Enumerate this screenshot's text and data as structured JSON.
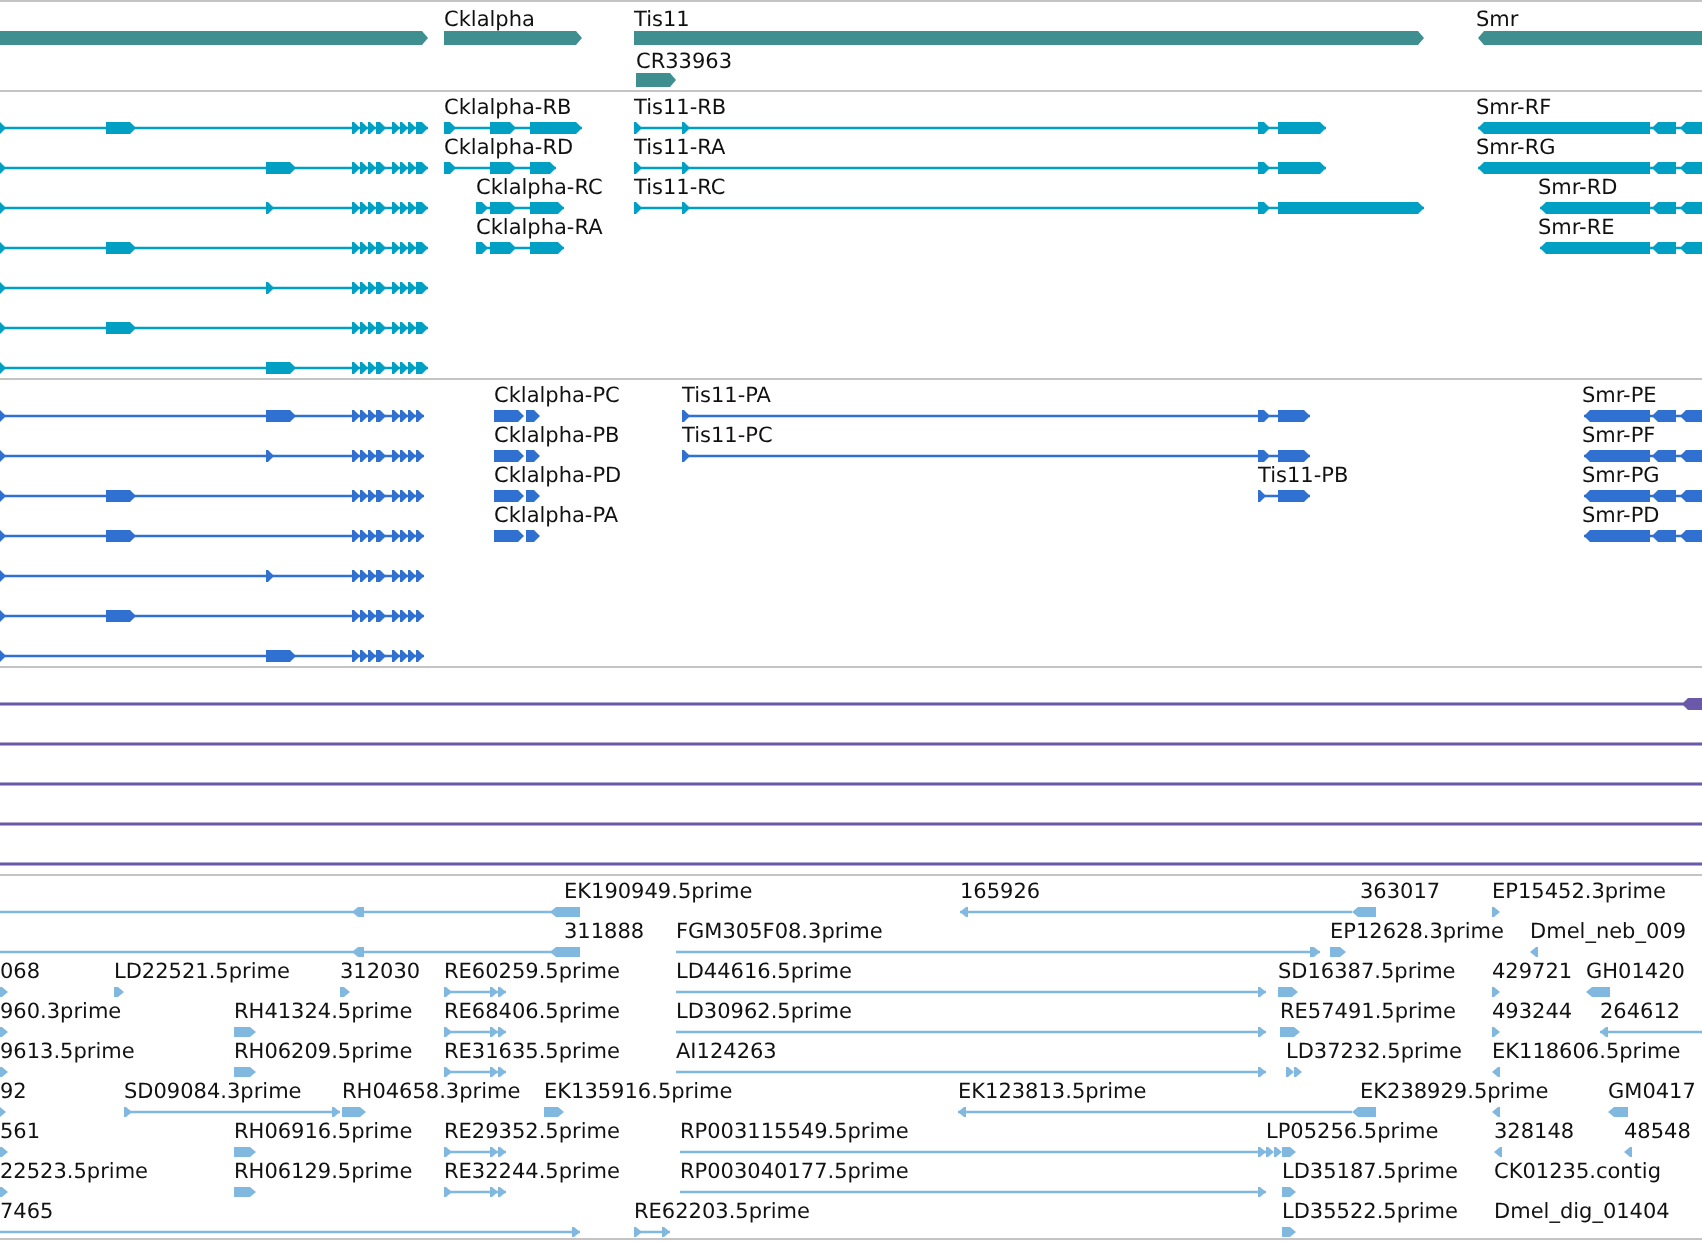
{
  "tracks": [
    {
      "kind": "gene",
      "color": "#3f8f91",
      "features": [
        {
          "reverse": false
        },
        {
          "label": "Cklalpha",
          "reverse": false
        },
        {
          "label": "Tis11",
          "reverse": false
        },
        {
          "label": "CR33963",
          "reverse": false
        },
        {
          "label": "Smr",
          "reverse": true
        }
      ]
    },
    {
      "kind": "transcript",
      "color": "#00a0c4",
      "features": [
        {
          "reverse": false
        },
        {
          "reverse": false
        },
        {
          "reverse": false
        },
        {
          "reverse": false
        },
        {
          "reverse": false
        },
        {
          "reverse": false
        },
        {
          "reverse": false
        },
        {
          "label": "Cklalpha-RB",
          "reverse": false
        },
        {
          "label": "Cklalpha-RD",
          "reverse": false
        },
        {
          "label": "Cklalpha-RC",
          "reverse": false
        },
        {
          "label": "Cklalpha-RA",
          "reverse": false
        },
        {
          "label": "Tis11-RB",
          "reverse": false
        },
        {
          "label": "Tis11-RA",
          "reverse": false
        },
        {
          "label": "Tis11-RC",
          "reverse": false
        },
        {
          "label": "Smr-RF",
          "reverse": true
        },
        {
          "label": "Smr-RG",
          "reverse": true
        },
        {
          "label": "Smr-RD",
          "reverse": true
        },
        {
          "label": "Smr-RE",
          "reverse": true
        }
      ]
    },
    {
      "kind": "transcript",
      "color": "#3070d0",
      "features": [
        {
          "reverse": false
        },
        {
          "reverse": false
        },
        {
          "reverse": false
        },
        {
          "reverse": false
        },
        {
          "reverse": false
        },
        {
          "reverse": false
        },
        {
          "reverse": false
        },
        {
          "label": "Cklalpha-PC",
          "reverse": false
        },
        {
          "label": "Cklalpha-PB",
          "reverse": false
        },
        {
          "label": "Cklalpha-PD",
          "reverse": false
        },
        {
          "label": "Cklalpha-PA",
          "reverse": false
        },
        {
          "label": "Tis11-PA",
          "reverse": false
        },
        {
          "label": "Tis11-PC",
          "reverse": false
        },
        {
          "label": "Tis11-PB",
          "reverse": false
        },
        {
          "label": "Smr-PE",
          "reverse": true
        },
        {
          "label": "Smr-PF",
          "reverse": true
        },
        {
          "label": "Smr-PG",
          "reverse": true
        },
        {
          "label": "Smr-PD",
          "reverse": true
        }
      ]
    },
    {
      "kind": "line",
      "color": "#6a58a8",
      "features": [
        {
          "reverse": true
        }
      ]
    },
    {
      "kind": "est",
      "color": "#80b8e0",
      "features": [
        {
          "label": "EK190949.5prime",
          "reverse": true
        },
        {
          "label": "165926",
          "reverse": true
        },
        {
          "label": "363017",
          "reverse": true
        },
        {
          "label": "EP15452.3prime",
          "reverse": false
        },
        {
          "label": "311888",
          "reverse": true
        },
        {
          "label": "FGM305F08.3prime",
          "reverse": false
        },
        {
          "label": "EP12628.3prime",
          "reverse": false
        },
        {
          "label": "Dmel_neb_009",
          "reverse": true
        },
        {
          "label": "068",
          "reverse": false
        },
        {
          "label": "LD22521.5prime",
          "reverse": false
        },
        {
          "label": "312030",
          "reverse": false
        },
        {
          "label": "RE60259.5prime",
          "reverse": false
        },
        {
          "label": "LD44616.5prime",
          "reverse": false
        },
        {
          "label": "SD16387.5prime",
          "reverse": false
        },
        {
          "label": "429721",
          "reverse": false
        },
        {
          "label": "GH01420",
          "reverse": true
        },
        {
          "label": "960.3prime",
          "reverse": false
        },
        {
          "label": "RH41324.5prime",
          "reverse": false
        },
        {
          "label": "RE68406.5prime",
          "reverse": false
        },
        {
          "label": "LD30962.5prime",
          "reverse": false
        },
        {
          "label": "RE57491.5prime",
          "reverse": false
        },
        {
          "label": "493244",
          "reverse": false
        },
        {
          "label": "264612",
          "reverse": true
        },
        {
          "label": "9613.5prime",
          "reverse": false
        },
        {
          "label": "RH06209.5prime",
          "reverse": false
        },
        {
          "label": "RE31635.5prime",
          "reverse": false
        },
        {
          "label": "AI124263",
          "reverse": false
        },
        {
          "label": "LD37232.5prime",
          "reverse": false
        },
        {
          "label": "EK118606.5prime",
          "reverse": true
        },
        {
          "label": "92",
          "reverse": false
        },
        {
          "label": "SD09084.3prime",
          "reverse": false
        },
        {
          "label": "RH04658.3prime",
          "reverse": false
        },
        {
          "label": "EK135916.5prime",
          "reverse": false
        },
        {
          "label": "EK123813.5prime",
          "reverse": true
        },
        {
          "label": "EK238929.5prime",
          "reverse": true
        },
        {
          "reverse": true
        },
        {
          "label": "GM0417",
          "reverse": true
        },
        {
          "label": "561",
          "reverse": false
        },
        {
          "label": "RH06916.5prime",
          "reverse": false
        },
        {
          "label": "RE29352.5prime",
          "reverse": false
        },
        {
          "label": "RP003115549.5prime",
          "reverse": false
        },
        {
          "label": "LP05256.5prime",
          "reverse": false
        },
        {
          "label": "328148",
          "reverse": true
        },
        {
          "label": "48548",
          "reverse": true
        },
        {
          "label": "22523.5prime",
          "reverse": false
        },
        {
          "label": "RH06129.5prime",
          "reverse": false
        },
        {
          "label": "RE32244.5prime",
          "reverse": false
        },
        {
          "label": "RP003040177.5prime",
          "reverse": false
        },
        {
          "label": "LD35187.5prime",
          "reverse": false
        },
        {
          "label": "CK01235.contig"
        },
        {
          "label": "7465",
          "reverse": false
        },
        {
          "label": "RE62203.5prime",
          "reverse": false
        },
        {
          "label": "LD35522.5prime",
          "reverse": false
        },
        {
          "label": "Dmel_dig_01404"
        }
      ]
    }
  ]
}
